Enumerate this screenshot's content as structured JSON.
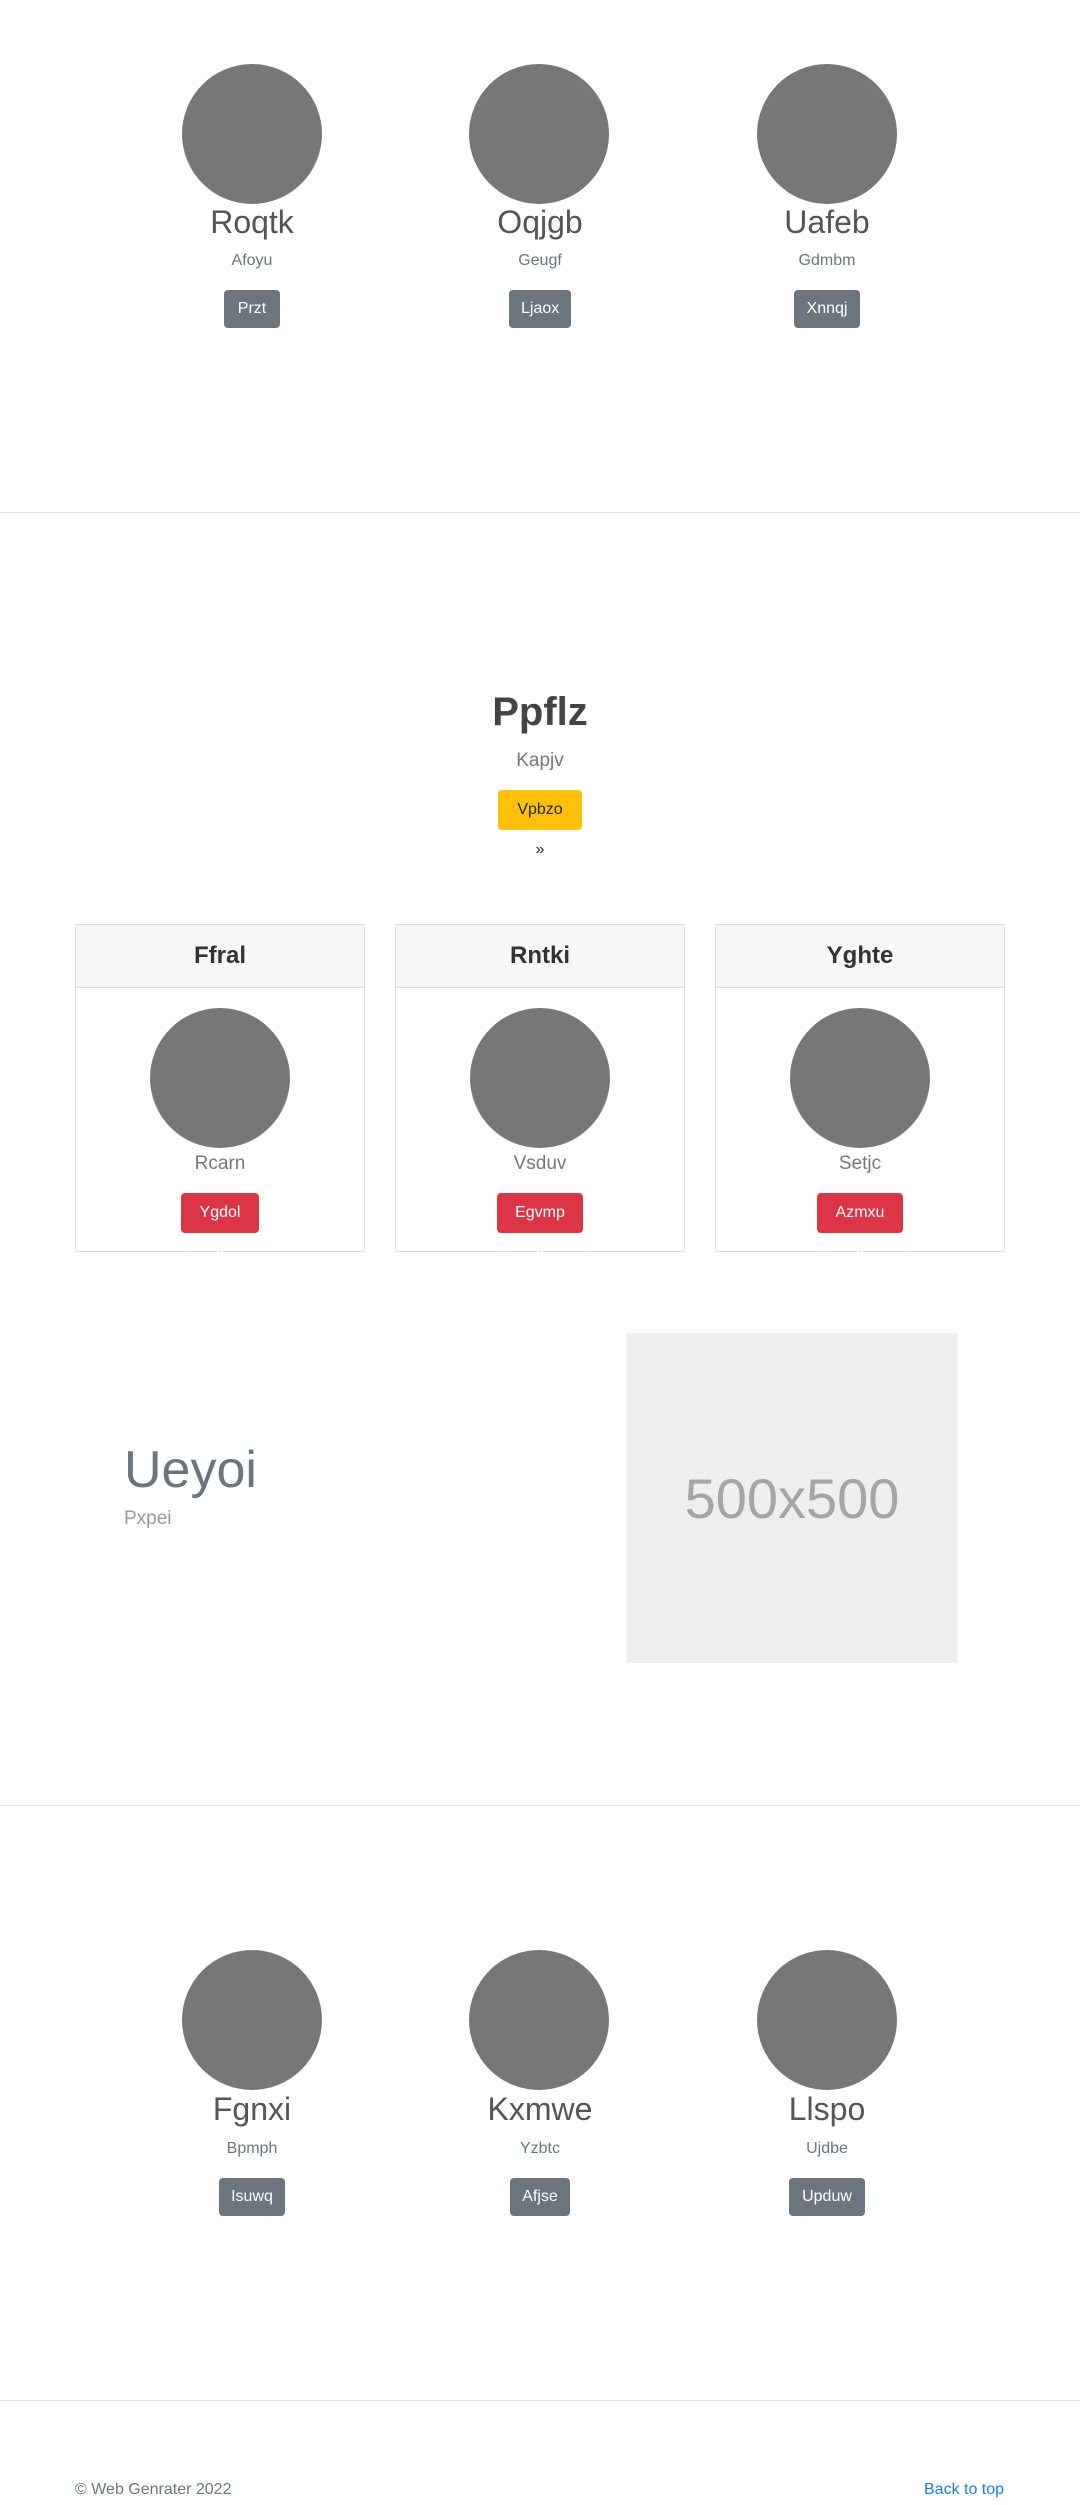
{
  "top_team": [
    {
      "name": "Roqtk",
      "subtitle": "Afoyu",
      "button": "Przt"
    },
    {
      "name": "Oqjgb",
      "subtitle": "Geugf",
      "button": "Ljaox"
    },
    {
      "name": "Uafeb",
      "subtitle": "Gdmbm",
      "button": "Xnnqj"
    }
  ],
  "hero": {
    "title": "Ppflz",
    "subtitle": "Kapjv",
    "button": "Vpbzo »"
  },
  "cards": [
    {
      "header": "Ffral",
      "subtitle": "Rcarn",
      "button": "Ygdol »"
    },
    {
      "header": "Rntki",
      "subtitle": "Vsduv",
      "button": "Egvmp »"
    },
    {
      "header": "Yghte",
      "subtitle": "Setjc",
      "button": "Azmxu »"
    }
  ],
  "feature": {
    "title": "Ueyoi",
    "subtitle": "Pxpei",
    "image_placeholder": "500x500"
  },
  "bottom_team": [
    {
      "name": "Fgnxi",
      "subtitle": "Bpmph",
      "button": "Isuwq"
    },
    {
      "name": "Kxmwe",
      "subtitle": "Yzbtc",
      "button": "Afjse"
    },
    {
      "name": "Llspo",
      "subtitle": "Ujdbe",
      "button": "Upduw"
    }
  ],
  "footer": {
    "copyright": "© Web Genrater 2022",
    "back_to_top": "Back to top"
  },
  "colors": {
    "avatar": "#777777",
    "button_gray": "#6c757d",
    "button_yellow": "#ffc107",
    "button_red": "#dc3545",
    "link": "#1c7ee3"
  }
}
